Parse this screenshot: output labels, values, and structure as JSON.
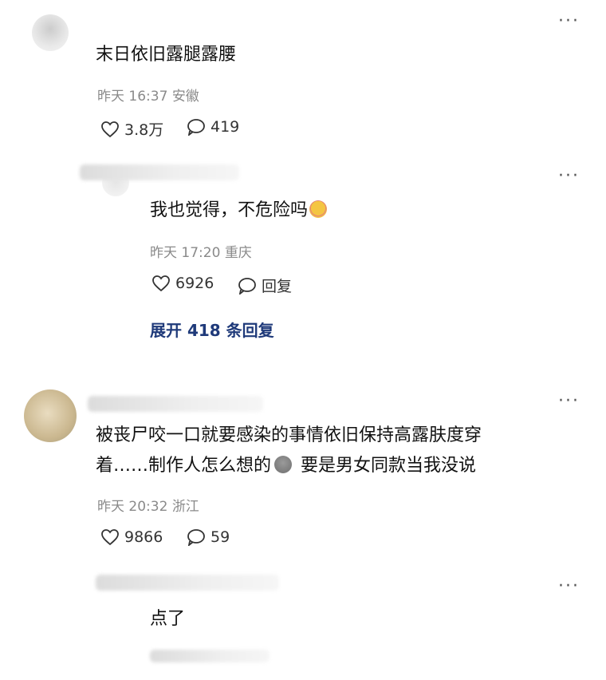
{
  "comments": [
    {
      "text": "末日依旧露腿露腰",
      "time": "昨天 16:37",
      "location": "安徽",
      "likes": "3.8万",
      "replies": "419"
    },
    {
      "text": "我也觉得，不危险吗",
      "time": "昨天 17:20",
      "location": "重庆",
      "likes": "6926",
      "reply_label": "回复",
      "expand": "展开 418 条回复"
    },
    {
      "text_line1": "被丧尸咬一口就要感染的事情依旧保持高露肤度穿",
      "text_line2a": "着……制作人怎么想的",
      "text_line2b": " 要是男女同款当我没说",
      "time": "昨天 20:32",
      "location": "浙江",
      "likes": "9866",
      "replies": "59"
    },
    {
      "text": "点了"
    }
  ],
  "more_label": "···",
  "colors": {
    "link": "#1f3a7a",
    "meta": "#8a8a8a"
  }
}
